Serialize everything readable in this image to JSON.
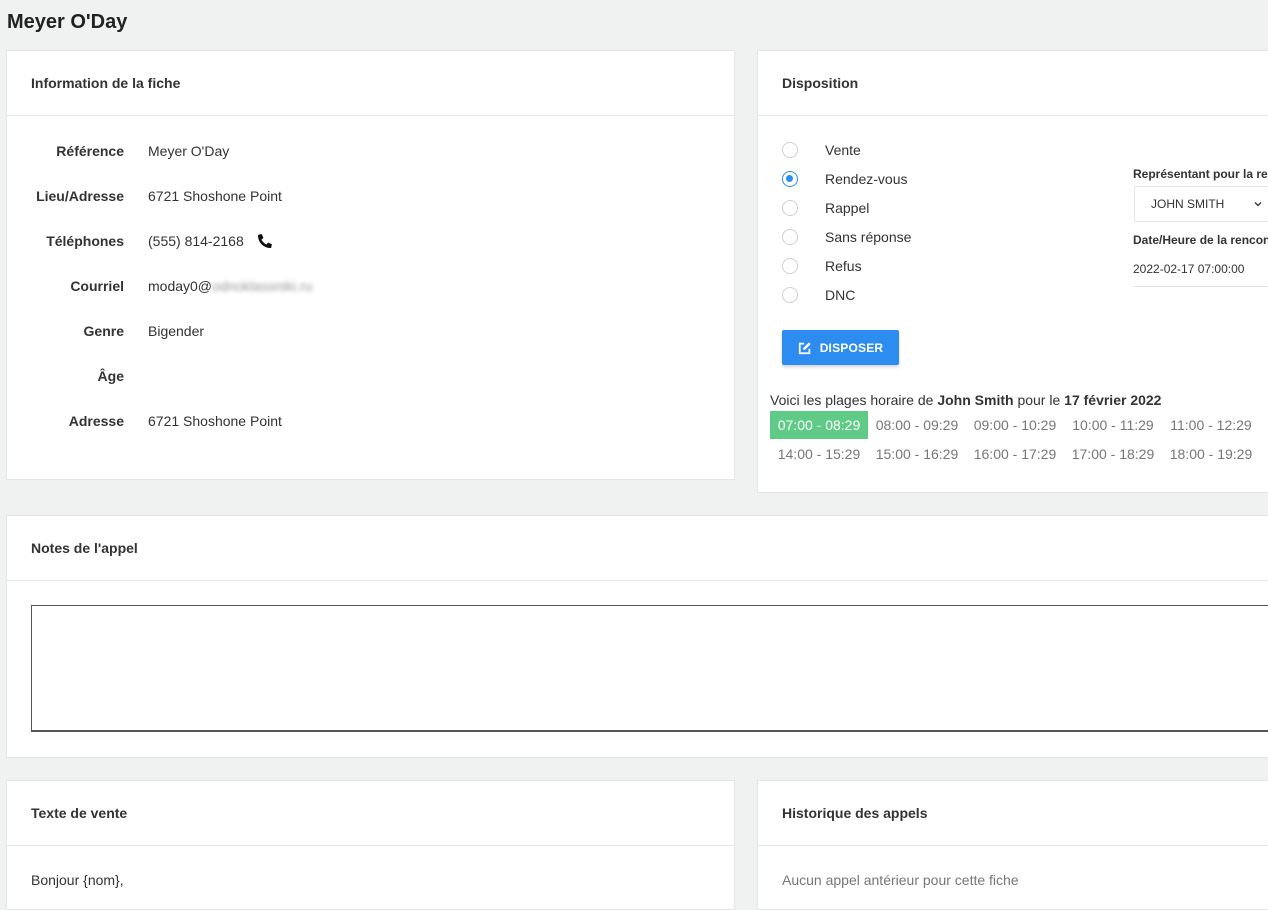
{
  "page": {
    "title": "Meyer O'Day"
  },
  "info": {
    "header": "Information de la fiche",
    "rows": [
      {
        "label": "Référence",
        "value": "Meyer O'Day"
      },
      {
        "label": "Lieu/Adresse",
        "value": "6721 Shoshone Point"
      },
      {
        "label": "Téléphones",
        "value": "(555) 814-2168"
      },
      {
        "label": "Courriel",
        "value": "moday0@",
        "blurred": "odnoklassniki.ru"
      },
      {
        "label": "Genre",
        "value": "Bigender"
      },
      {
        "label": "Âge",
        "value": ""
      },
      {
        "label": "Adresse",
        "value": "6721 Shoshone Point"
      }
    ],
    "phone_icon": "phone-icon"
  },
  "disposition": {
    "header": "Disposition",
    "options": [
      {
        "label": "Vente",
        "checked": false
      },
      {
        "label": "Rendez-vous",
        "checked": true
      },
      {
        "label": "Rappel",
        "checked": false
      },
      {
        "label": "Sans réponse",
        "checked": false
      },
      {
        "label": "Refus",
        "checked": false
      },
      {
        "label": "DNC",
        "checked": false
      }
    ],
    "button_label": "DISPOSER",
    "rep_label": "Représentant pour la rencontre",
    "rep_value": "JOHN SMITH",
    "date_label": "Date/Heure de la rencontre",
    "date_value": "2022-02-17 07:00:00",
    "slots_intro": {
      "prefix": "Voici les plages horaire de ",
      "name": "John Smith",
      "middle": " pour le ",
      "date": "17 février 2022"
    },
    "slots": [
      [
        "07:00 - 08:29",
        "08:00 - 09:29",
        "09:00 - 10:29",
        "10:00 - 11:29",
        "11:00 - 12:29"
      ],
      [
        "14:00 - 15:29",
        "15:00 - 16:29",
        "16:00 - 17:29",
        "17:00 - 18:29",
        "18:00 - 19:29"
      ]
    ],
    "selected_slot": "07:00 - 08:29",
    "accent_color": "#2d8cf0",
    "selected_slot_color": "#5fcb86"
  },
  "notes": {
    "header": "Notes de l'appel",
    "value": ""
  },
  "sales": {
    "header": "Texte de vente",
    "text": "Bonjour {nom},"
  },
  "history": {
    "header": "Historique des appels",
    "empty_text": "Aucun appel antérieur pour cette fiche"
  }
}
